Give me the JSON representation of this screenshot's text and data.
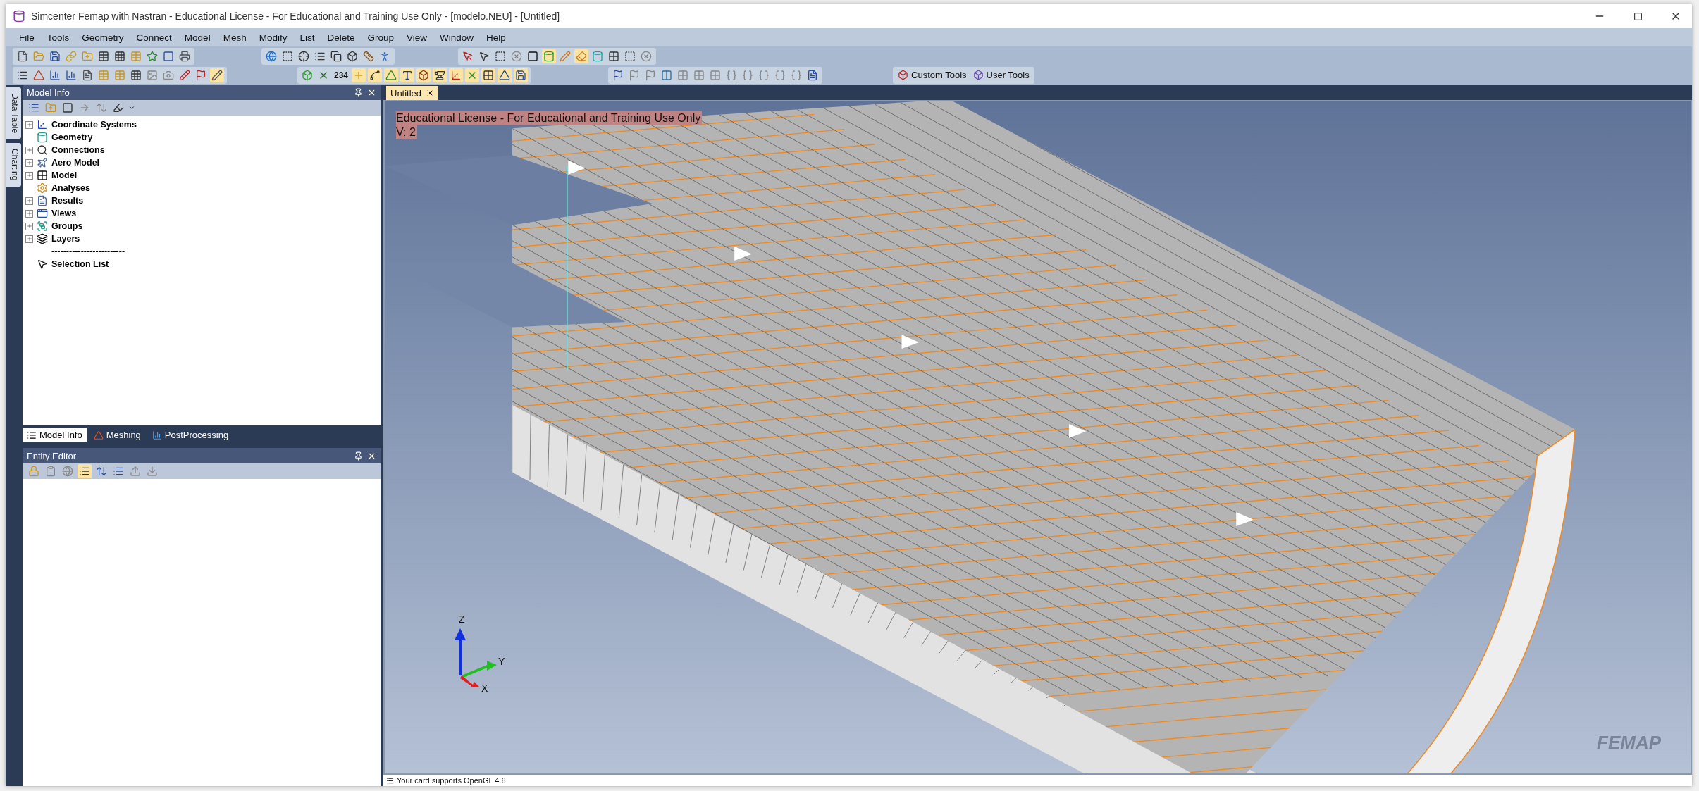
{
  "window": {
    "title": "Simcenter Femap with Nastran - Educational License - For Educational and Training Use Only - [modelo.NEU] - [Untitled]"
  },
  "menu": [
    "File",
    "Tools",
    "Geometry",
    "Connect",
    "Model",
    "Mesh",
    "Modify",
    "List",
    "Delete",
    "Group",
    "View",
    "Window",
    "Help"
  ],
  "toolbars": {
    "custom_tools": "Custom Tools",
    "user_tools": "User Tools",
    "label_number": "234"
  },
  "side_tabs": [
    {
      "label": "Data Table"
    },
    {
      "label": "Charting"
    }
  ],
  "model_info": {
    "title": "Model Info",
    "tree": [
      {
        "label": "Coordinate Systems",
        "kind": "group"
      },
      {
        "label": "Geometry",
        "kind": "leaf"
      },
      {
        "label": "Connections",
        "kind": "group"
      },
      {
        "label": "Aero Model",
        "kind": "group"
      },
      {
        "label": "Model",
        "kind": "group"
      },
      {
        "label": "Analyses",
        "kind": "leaf"
      },
      {
        "label": "Results",
        "kind": "group"
      },
      {
        "label": "Views",
        "kind": "group"
      },
      {
        "label": "Groups",
        "kind": "group"
      },
      {
        "label": "Layers",
        "kind": "group"
      },
      {
        "label": "-------------------------",
        "kind": "separator"
      },
      {
        "label": "Selection List",
        "kind": "leaf"
      }
    ]
  },
  "panel_tabs": [
    {
      "label": "Model Info",
      "selected": true
    },
    {
      "label": "Meshing",
      "selected": false
    },
    {
      "label": "PostProcessing",
      "selected": false
    }
  ],
  "entity_editor": {
    "title": "Entity Editor"
  },
  "document_tabs": [
    {
      "label": "Untitled",
      "selected": true
    }
  ],
  "viewport": {
    "license_text": "Educational License - For Educational and Training Use Only",
    "version": "V: 2",
    "axes": [
      "Z",
      "Y",
      "X"
    ],
    "logo": "FEMAP"
  },
  "status_bar": "Your card supports OpenGL 4.6"
}
